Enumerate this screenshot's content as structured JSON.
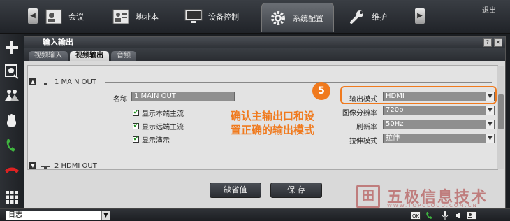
{
  "topnav": {
    "tabs": [
      {
        "label": "会议",
        "icon": "contacts-card-icon"
      },
      {
        "label": "地址本",
        "icon": "address-book-icon"
      },
      {
        "label": "设备控制",
        "icon": "monitor-icon"
      },
      {
        "label": "系统配置",
        "icon": "gear-icon",
        "active": true
      },
      {
        "label": "维护",
        "icon": "wrench-icon"
      }
    ],
    "logout": "退出"
  },
  "window": {
    "title": "输入输出",
    "subtabs": [
      "视频输入",
      "视频输出",
      "音频"
    ],
    "active_subtab": "视频输出",
    "section1": "1 MAIN OUT",
    "section2": "2 HDMI OUT",
    "name_label": "名称",
    "name_value": "1 MAIN OUT",
    "checkboxes": [
      {
        "label": "显示本端主流",
        "checked": true
      },
      {
        "label": "显示远端主流",
        "checked": true
      },
      {
        "label": "显示演示",
        "checked": true
      }
    ],
    "fields": [
      {
        "label": "输出模式",
        "value": "HDMI"
      },
      {
        "label": "图像分辨率",
        "value": "720p"
      },
      {
        "label": "刷新率",
        "value": "50Hz"
      },
      {
        "label": "拉伸模式",
        "value": "拉伸"
      }
    ],
    "default_button": "缺省值",
    "save_button": "保  存"
  },
  "callout": {
    "number": "5",
    "text_line1": "确认主输出口和设",
    "text_line2": "置正确的输出模式",
    "color": "#f07a1e"
  },
  "bottombar": {
    "log_label": "日志"
  },
  "watermark": {
    "text": "五极信息技术",
    "url": "WWW.TOPCLOUD.COM.CN"
  }
}
